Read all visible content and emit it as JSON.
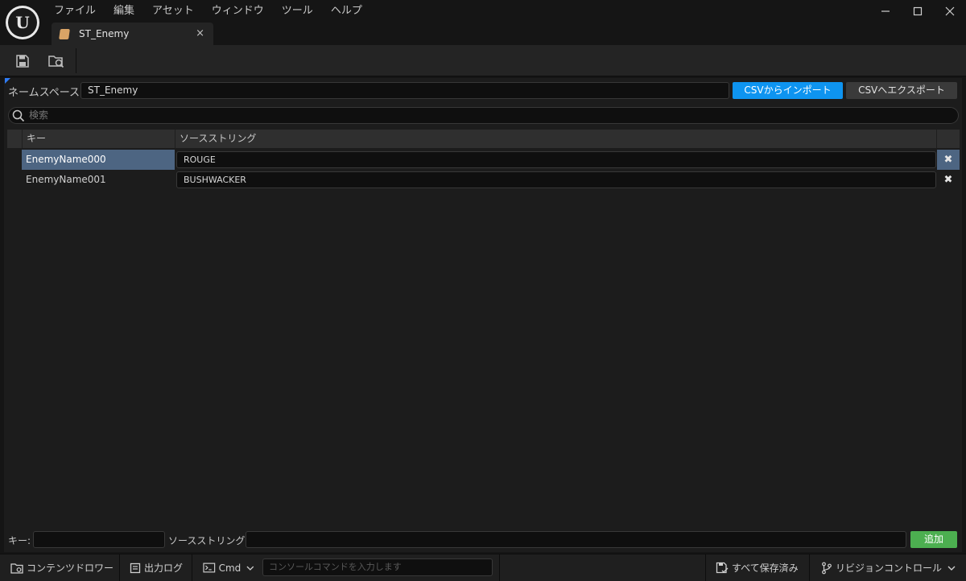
{
  "app": {
    "logo_letter": "U"
  },
  "menubar": {
    "items": [
      "ファイル",
      "編集",
      "アセット",
      "ウィンドウ",
      "ツール",
      "ヘルプ"
    ]
  },
  "window_controls": {
    "minimize": "—",
    "maximize": "☐",
    "close": "✕"
  },
  "tab": {
    "label": "ST_Enemy",
    "close": "×"
  },
  "toolbar": {
    "save_icon": "save-icon",
    "browse_icon": "browse-to-asset-icon"
  },
  "namespace": {
    "label": "ネームスペース:",
    "value": "ST_Enemy"
  },
  "buttons": {
    "import_csv": "CSVからインポート",
    "export_csv": "CSVへエクスポート",
    "add": "追加"
  },
  "search": {
    "placeholder": "検索"
  },
  "table": {
    "columns": [
      "キー",
      "ソースストリング"
    ],
    "rows": [
      {
        "key": "EnemyName000",
        "source": "ROUGE",
        "selected": true
      },
      {
        "key": "EnemyName001",
        "source": "BUSHWACKER",
        "selected": false
      }
    ],
    "delete_glyph": "✖"
  },
  "add_row": {
    "key_label": "キー:",
    "source_label": "ソースストリング:",
    "key_value": "",
    "source_value": ""
  },
  "statusbar": {
    "content_drawer": "コンテンツドロワー",
    "output_log": "出力ログ",
    "cmd": "Cmd",
    "console_placeholder": "コンソールコマンドを入力します",
    "save_all": "すべて保存済み",
    "revision_control": "リビジョンコントロール"
  },
  "colors": {
    "import_button": "#0e94f0",
    "add_button": "#4caf50",
    "selected_row": "#4d6582"
  }
}
